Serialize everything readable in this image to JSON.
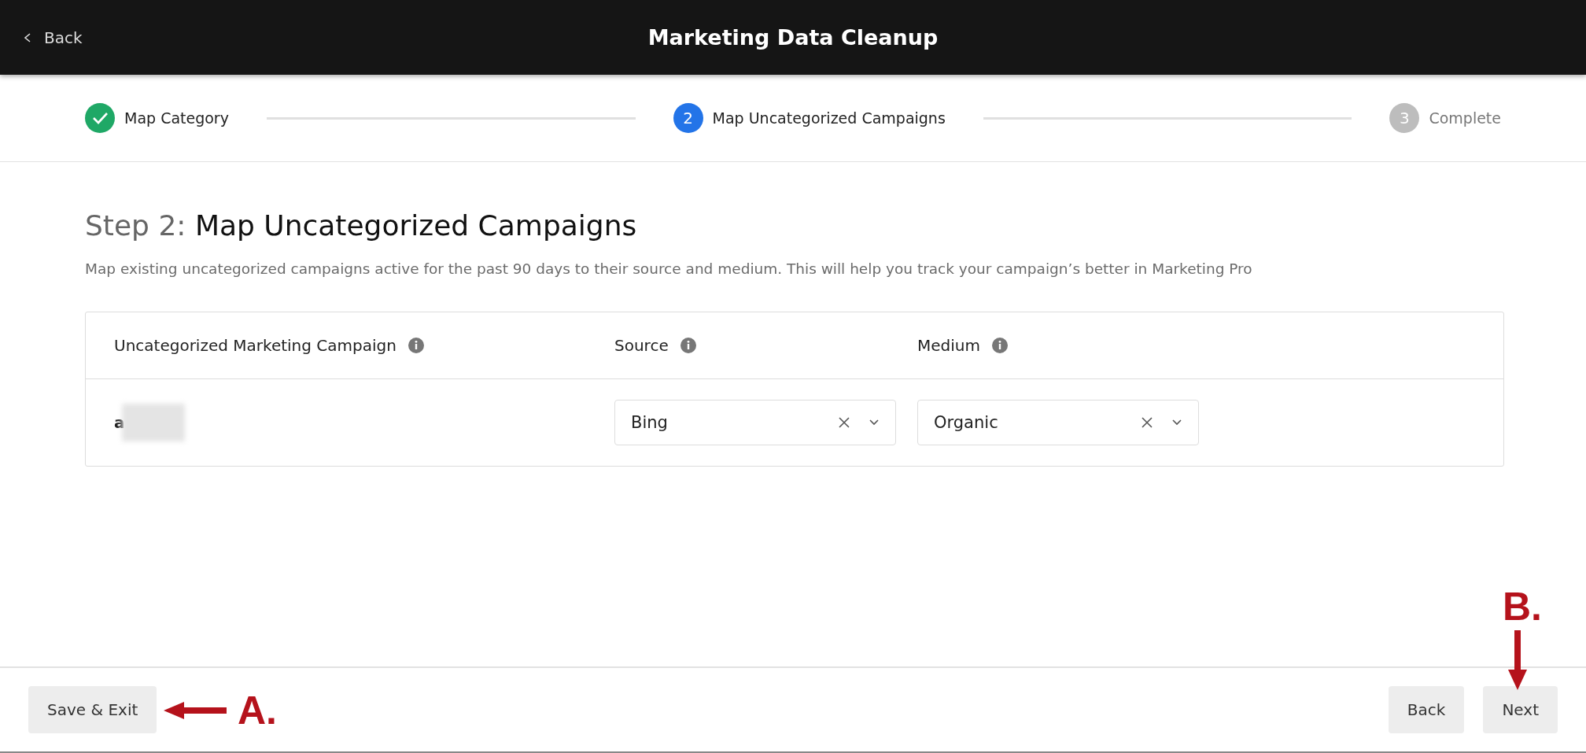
{
  "header": {
    "back": "Back",
    "title": "Marketing Data Cleanup"
  },
  "stepper": [
    {
      "label": "Map Category",
      "done": true,
      "selected": false
    },
    {
      "number": "2",
      "label": "Map Uncategorized Campaigns",
      "done": false,
      "selected": true
    },
    {
      "number": "3",
      "label": "Complete",
      "done": false,
      "selected": false
    }
  ],
  "heading": {
    "prefix": "Step 2:",
    "title": "Map Uncategorized Campaigns"
  },
  "description": "Map existing uncategorized campaigns active for the past 90 days to their source and medium. This will help you track your campaign’s better in Marketing Pro",
  "table": {
    "columns": [
      "Uncategorized Marketing Campaign",
      "Source",
      "Medium"
    ],
    "rows": [
      {
        "campaign": "a",
        "redacted": true,
        "source": "Bing",
        "medium": "Organic"
      }
    ]
  },
  "footer": {
    "left_buttons": [
      "Save & Exit"
    ],
    "right_buttons": [
      "Back",
      "Next"
    ]
  },
  "annotations": [
    {
      "label": "A.",
      "kind": "left"
    },
    {
      "label": "B.",
      "kind": "down"
    }
  ]
}
